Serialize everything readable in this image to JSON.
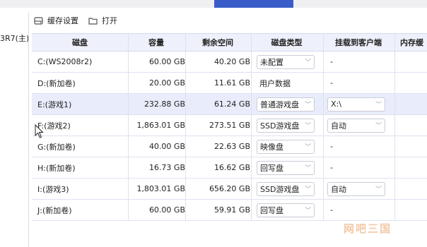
{
  "left_panel": {
    "label": "3R7(主)"
  },
  "toolbar": {
    "cache_label": "缓存设置",
    "open_label": "打开"
  },
  "columns": [
    "磁盘",
    "容量",
    "剩余空间",
    "磁盘类型",
    "挂载到客户端",
    "内存缓"
  ],
  "rows": [
    {
      "disk": "C:(WS2008r2)",
      "capacity": "60.00 GB",
      "free": "40.20 GB",
      "type": "未配置",
      "type_dropdown": true,
      "mount": "-",
      "mount_dropdown": false
    },
    {
      "disk": "D:(新加卷)",
      "capacity": "20.00 GB",
      "free": "11.61 GB",
      "type": "用户数据",
      "type_dropdown": false,
      "mount": "-",
      "mount_dropdown": false
    },
    {
      "disk": "E:(游戏1)",
      "capacity": "232.88 GB",
      "free": "61.24 GB",
      "type": "普通游戏盘",
      "type_dropdown": true,
      "mount": "X:\\",
      "mount_dropdown": true,
      "selected": true
    },
    {
      "disk": "F:(游戏2)",
      "capacity": "1,863.01 GB",
      "free": "273.51 GB",
      "type": "SSD游戏盘",
      "type_dropdown": true,
      "mount": "自动",
      "mount_dropdown": true
    },
    {
      "disk": "G:(新加卷)",
      "capacity": "40.00 GB",
      "free": "22.63 GB",
      "type": "映像盘",
      "type_dropdown": true,
      "mount": "-",
      "mount_dropdown": false
    },
    {
      "disk": "H:(新加卷)",
      "capacity": "16.73 GB",
      "free": "16.62 GB",
      "type": "回写盘",
      "type_dropdown": true,
      "mount": "-",
      "mount_dropdown": false
    },
    {
      "disk": "I:(游戏3)",
      "capacity": "1,803.01 GB",
      "free": "656.20 GB",
      "type": "SSD游戏盘",
      "type_dropdown": true,
      "mount": "自动",
      "mount_dropdown": true
    },
    {
      "disk": "J:(新加卷)",
      "capacity": "60.00 GB",
      "free": "59.91 GB",
      "type": "回写盘",
      "type_dropdown": true,
      "mount": "-",
      "mount_dropdown": false
    }
  ],
  "watermark": "网吧三国",
  "colors": {
    "accent": "#3a5cc8",
    "header_bg": "#eef0fb",
    "selected_bg": "#e9ecfb"
  }
}
